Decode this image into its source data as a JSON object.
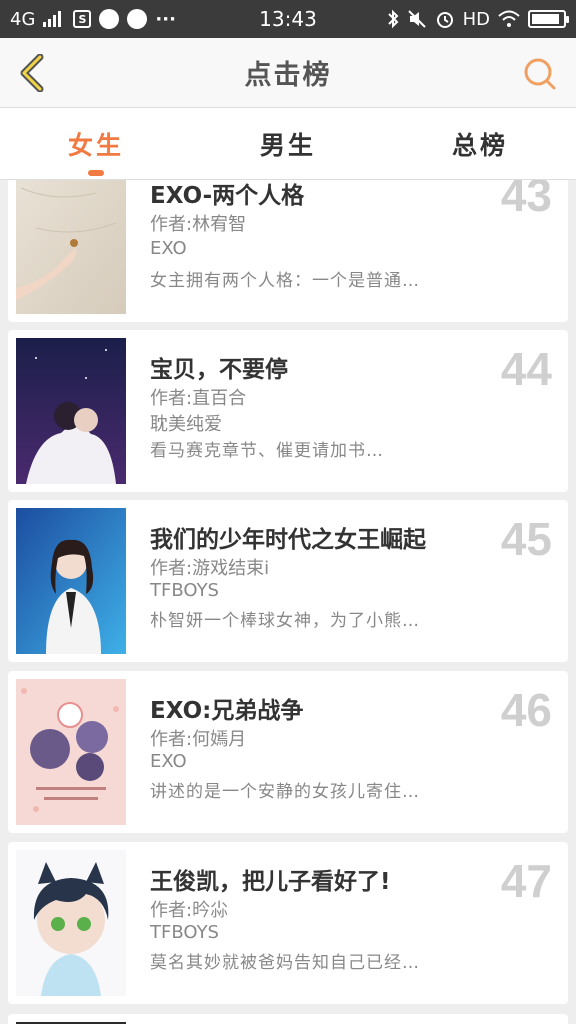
{
  "status_bar": {
    "network": "4G",
    "time": "13:43",
    "hd_label": "HD",
    "dots": "···",
    "battery_level": 0.9,
    "icons": [
      "signal-icon",
      "s-app-icon",
      "camera-app-icon",
      "pen-app-icon",
      "bluetooth-icon",
      "mute-icon",
      "alarm-icon",
      "wifi-icon",
      "battery-icon"
    ]
  },
  "nav": {
    "title": "点击榜",
    "back_icon": "chevron-left-icon",
    "search_icon": "search-icon",
    "accent_color": "#f0a060"
  },
  "tabs": [
    {
      "label": "女生",
      "active": true
    },
    {
      "label": "男生",
      "active": false
    },
    {
      "label": "总榜",
      "active": false
    }
  ],
  "accent_color": "#f07a42",
  "books": [
    {
      "rank": "43",
      "title": "EXO-两个人格",
      "author": "作者:林宥智",
      "category": "EXO",
      "desc": "女主拥有两个人格：一个是普通…",
      "cover": "cover-hand-on-sand"
    },
    {
      "rank": "44",
      "title": "宝贝，不要停",
      "author": "作者:直百合",
      "category": "耽美纯爱",
      "desc": "看马赛克章节、催更请加书…",
      "cover": "cover-couple-night-sky"
    },
    {
      "rank": "45",
      "title": "我们的少年时代之女王崛起",
      "author": "作者:游戏结束i",
      "category": "TFBOYS",
      "desc": "朴智妍一个棒球女神，为了小熊…",
      "cover": "cover-singer-stage"
    },
    {
      "rank": "46",
      "title": "EXO:兄弟战争",
      "author": "作者:何嫣月",
      "category": "EXO",
      "desc": "讲述的是一个安静的女孩儿寄住…",
      "cover": "cover-pink-circles"
    },
    {
      "rank": "47",
      "title": "王俊凯，把儿子看好了!",
      "author": "作者:昑尛",
      "category": "TFBOYS",
      "desc": "莫名其妙就被爸妈告知自己已经…",
      "cover": "cover-chibi-catboy"
    }
  ]
}
